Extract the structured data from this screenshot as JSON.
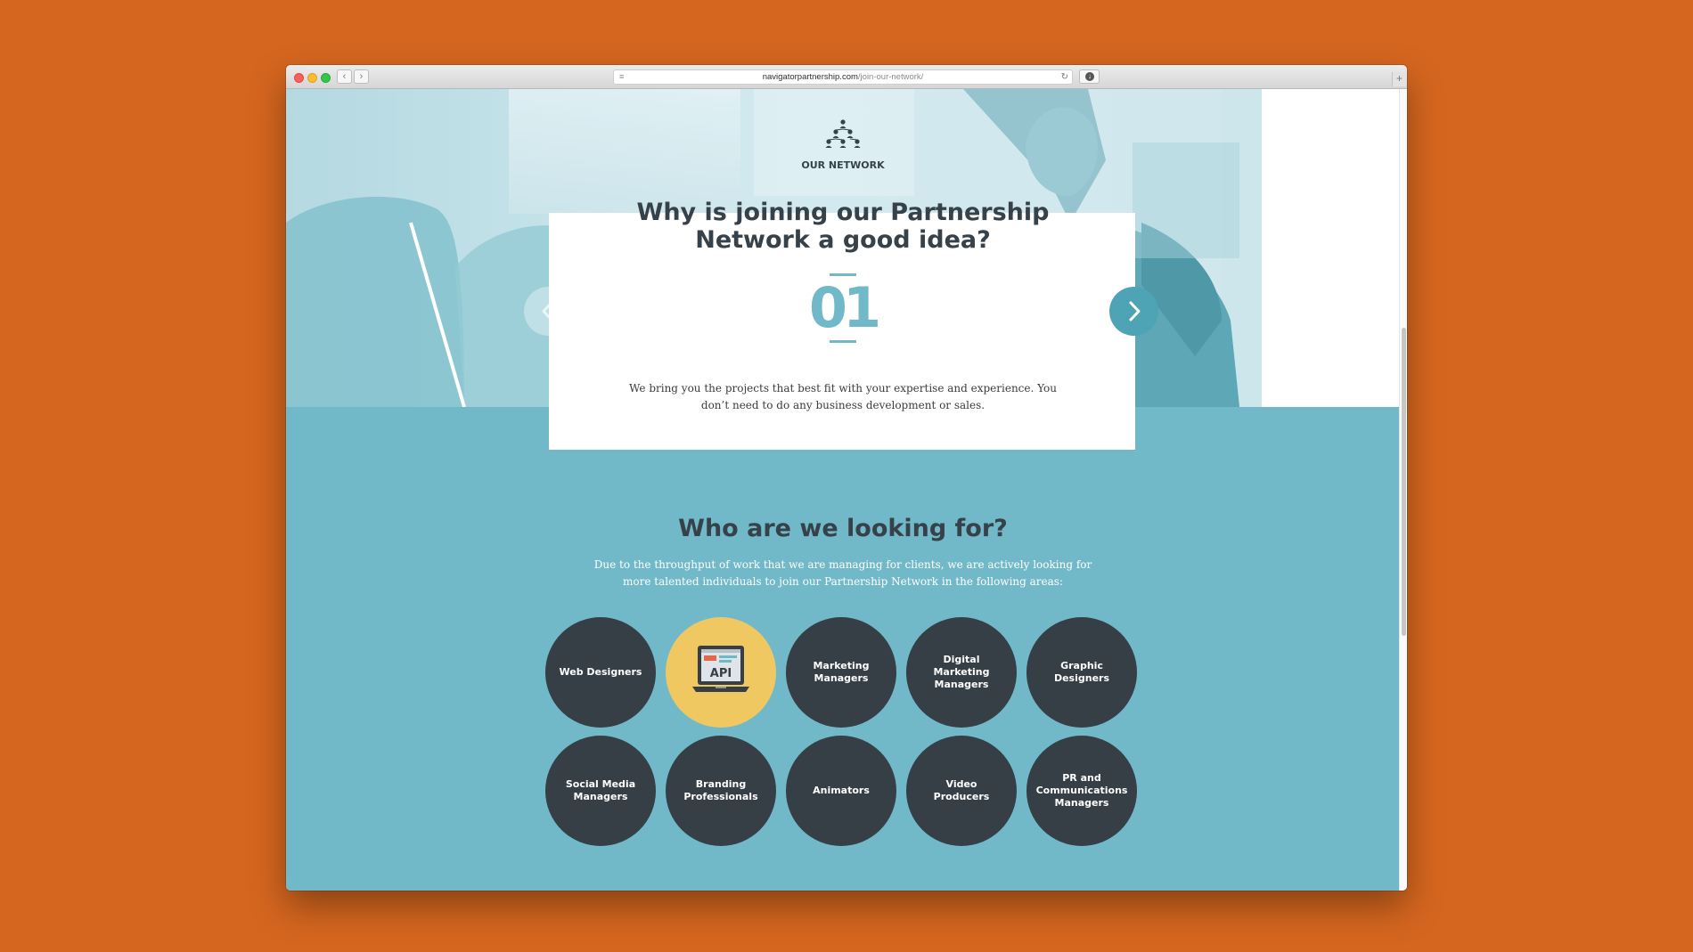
{
  "browser": {
    "url_domain": "navigatorpartnership.com",
    "url_path": "/join-our-network/",
    "back_glyph": "‹",
    "forward_glyph": "›",
    "reader_glyph": "≡",
    "reload_glyph": "↻",
    "download_glyph": "↓",
    "newtab_glyph": "+"
  },
  "header": {
    "icon": "network-people-icon",
    "title": "OUR NETWORK"
  },
  "slider": {
    "headline_line1": "Why is joining our Partnership",
    "headline_line2": "Network a good idea?",
    "number": "01",
    "text": "We bring you the projects that best fit with your expertise and experience. You don’t need to do any business development or sales.",
    "prev_glyph": "‹",
    "next_glyph": "›"
  },
  "who": {
    "title": "Who are we looking for?",
    "text": "Due to the throughput of work that we are managing for clients, we are actively looking for more talented individuals to join our Partnership Network in the following areas:"
  },
  "roles": [
    {
      "label": "Web Designers"
    },
    {
      "label": "API",
      "icon": "laptop-api-icon"
    },
    {
      "label": "Marketing Managers"
    },
    {
      "label": "Digital Marketing Managers"
    },
    {
      "label": "Graphic Designers"
    },
    {
      "label": "Social Media Managers"
    },
    {
      "label": "Branding Professionals"
    },
    {
      "label": "Animators"
    },
    {
      "label": "Video Producers"
    },
    {
      "label": "PR and Communications Managers"
    }
  ],
  "colors": {
    "background": "#d5661f",
    "teal": "#71b9c8",
    "dark": "#363e46",
    "highlight": "#f0c862"
  }
}
